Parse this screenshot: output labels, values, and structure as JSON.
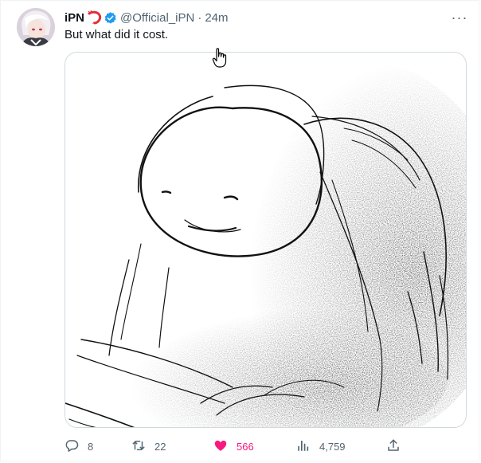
{
  "tweet": {
    "display_name": "iPN",
    "handle": "@Official_iPN",
    "separator": "·",
    "time": "24m",
    "text": "But what did it cost.",
    "more_label": "···"
  },
  "icons": {
    "emoji": "shrimp-emoji-icon",
    "verified": "verified-badge-icon",
    "more": "more-horizontal-icon",
    "reply": "reply-icon",
    "retweet": "retweet-icon",
    "like": "heart-filled-icon",
    "views": "views-bar-chart-icon",
    "share": "share-upload-icon"
  },
  "stats": {
    "replies": "8",
    "retweets": "22",
    "likes": "566",
    "views": "4,759"
  },
  "colors": {
    "like_active": "#f91880",
    "verified": "#1d9bf0",
    "muted": "#536471"
  }
}
